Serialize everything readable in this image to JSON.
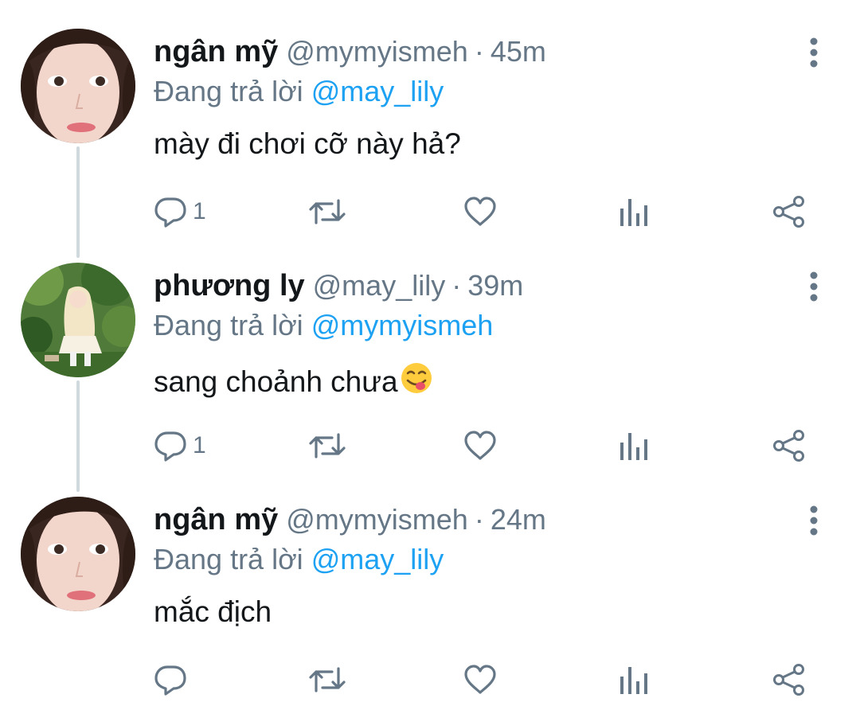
{
  "thread": {
    "reply_prefix": "Đang trả lời",
    "tweets": [
      {
        "display_name": "ngân mỹ",
        "handle": "@mymyismeh",
        "separator": "·",
        "time": "45m",
        "reply_to": "@may_lily",
        "text": "mày đi chơi cỡ này hả?",
        "reply_count": "1",
        "avatar": "portrait-avatar-icon"
      },
      {
        "display_name": "phương ly",
        "handle": "@may_lily",
        "separator": "·",
        "time": "39m",
        "reply_to": "@mymyismeh",
        "text": "sang choảnh chưa",
        "emoji": "yum-face-emoji",
        "reply_count": "1",
        "avatar": "garden-photo-avatar-icon"
      },
      {
        "display_name": "ngân mỹ",
        "handle": "@mymyismeh",
        "separator": "·",
        "time": "24m",
        "reply_to": "@may_lily",
        "text": "mắc địch",
        "reply_count": "",
        "avatar": "portrait-avatar-icon"
      }
    ]
  },
  "colors": {
    "name": "#14171a",
    "muted": "#657786",
    "link": "#1da1f2",
    "thread_line": "#cfd9de",
    "icon": "#657786"
  },
  "icons": {
    "reply": "reply-bubble-icon",
    "retweet": "retweet-icon",
    "like": "heart-icon",
    "analytics": "analytics-bars-icon",
    "share": "share-icon",
    "more": "more-vertical-icon"
  }
}
